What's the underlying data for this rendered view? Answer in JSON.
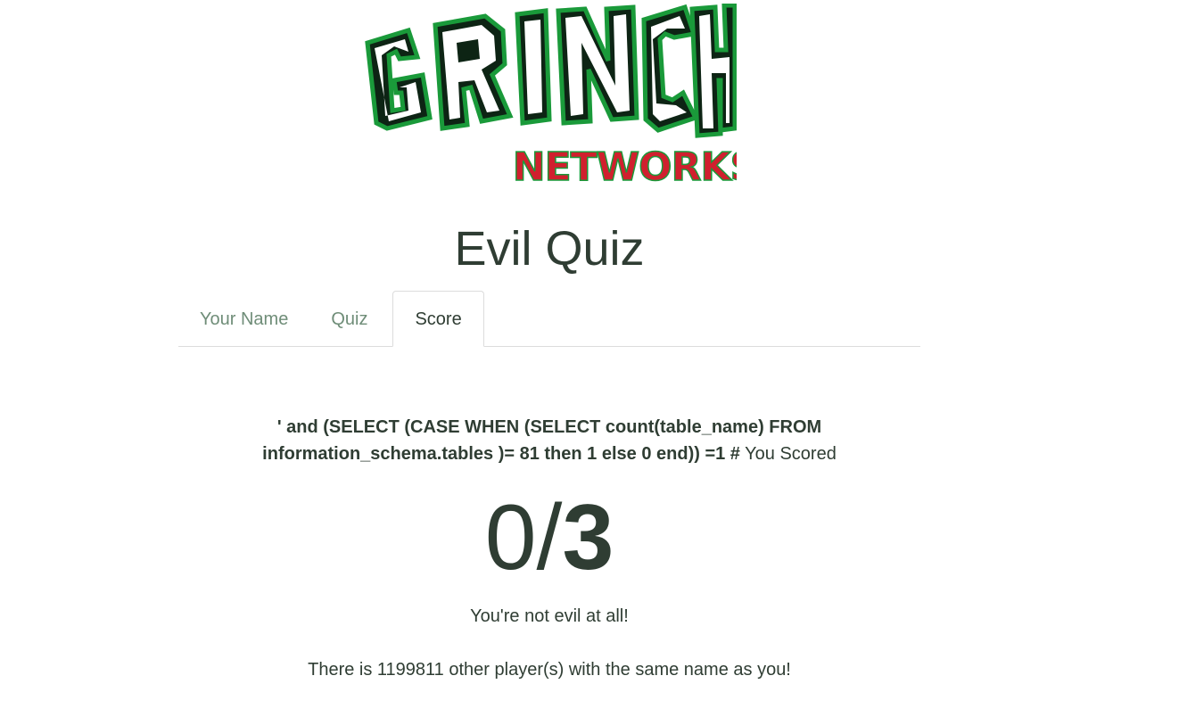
{
  "brand": {
    "logo_top": "GRINCH",
    "logo_bottom": "NETWORKS",
    "green": "#1a9a3a",
    "dark": "#0d2414",
    "red": "#d0202e"
  },
  "page": {
    "title": "Evil Quiz"
  },
  "tabs": [
    {
      "label": "Your Name",
      "active": false
    },
    {
      "label": "Quiz",
      "active": false
    },
    {
      "label": "Score",
      "active": true
    }
  ],
  "score": {
    "username": "' and (SELECT (CASE WHEN (SELECT count(table_name) FROM information_schema.tables )= 81 then 1 else 0 end)) =1 #",
    "you_scored": "You Scored",
    "numerator": "0",
    "separator": "/",
    "denominator": "3",
    "verdict": "You're not evil at all!",
    "same_name_text": "There is 1199811 other player(s) with the same name as you!"
  }
}
